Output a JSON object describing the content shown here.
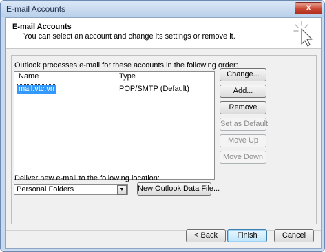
{
  "window": {
    "title": "E-mail Accounts",
    "close_glyph": "X"
  },
  "header": {
    "title": "E-mail Accounts",
    "subtitle": "You can select an account and change its settings or remove it.",
    "icon": "wizard-cursor-icon"
  },
  "accounts": {
    "instruction": "Outlook processes e-mail for these accounts in the following order:",
    "columns": [
      "Name",
      "Type"
    ],
    "rows": [
      {
        "name": "mail.vtc.vn",
        "type": "POP/SMTP (Default)",
        "selected": true
      }
    ]
  },
  "side_buttons": {
    "change": "Change...",
    "add": "Add...",
    "remove": "Remove",
    "set_default": "Set as Default",
    "move_up": "Move Up",
    "move_down": "Move Down"
  },
  "delivery": {
    "label": "Deliver new e-mail to the following location:",
    "selected": "Personal Folders",
    "new_file_button": "New Outlook Data File..."
  },
  "footer": {
    "back": "< Back",
    "finish": "Finish",
    "cancel": "Cancel"
  }
}
